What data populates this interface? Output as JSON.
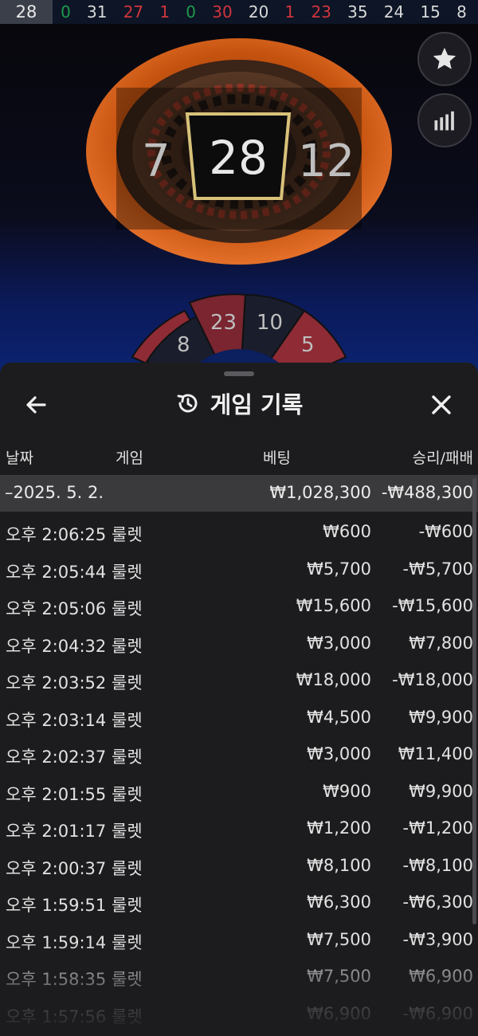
{
  "recent_results": {
    "current": "28",
    "numbers": [
      {
        "value": "0",
        "color": "green"
      },
      {
        "value": "31",
        "color": "black"
      },
      {
        "value": "27",
        "color": "red"
      },
      {
        "value": "1",
        "color": "red"
      },
      {
        "value": "0",
        "color": "green"
      },
      {
        "value": "30",
        "color": "red"
      },
      {
        "value": "20",
        "color": "black"
      },
      {
        "value": "1",
        "color": "red"
      },
      {
        "value": "23",
        "color": "red"
      },
      {
        "value": "35",
        "color": "black"
      },
      {
        "value": "24",
        "color": "black"
      },
      {
        "value": "15",
        "color": "black"
      },
      {
        "value": "8",
        "color": "black"
      }
    ]
  },
  "wheel": {
    "winning_number": "28",
    "left_neighbor": "7",
    "right_neighbor": "12",
    "lower_numbers": [
      "8",
      "23",
      "10",
      "5"
    ]
  },
  "side_buttons": {
    "favorite_icon": "star-icon",
    "stats_icon": "bar-chart-icon"
  },
  "history": {
    "title": "게임 기록",
    "columns": {
      "date": "날짜",
      "game": "게임",
      "bet": "베팅",
      "result": "승리/패배"
    },
    "date_group": {
      "label": "–2025. 5. 2.",
      "bet_total": "₩1,028,300",
      "result_total": "-₩488,300"
    },
    "rows": [
      {
        "time": "오후 2:06:25",
        "game": "룰렛",
        "bet": "₩600",
        "result": "-₩600"
      },
      {
        "time": "오후 2:05:44",
        "game": "룰렛",
        "bet": "₩5,700",
        "result": "-₩5,700"
      },
      {
        "time": "오후 2:05:06",
        "game": "룰렛",
        "bet": "₩15,600",
        "result": "-₩15,600"
      },
      {
        "time": "오후 2:04:32",
        "game": "룰렛",
        "bet": "₩3,000",
        "result": "₩7,800"
      },
      {
        "time": "오후 2:03:52",
        "game": "룰렛",
        "bet": "₩18,000",
        "result": "-₩18,000"
      },
      {
        "time": "오후 2:03:14",
        "game": "룰렛",
        "bet": "₩4,500",
        "result": "₩9,900"
      },
      {
        "time": "오후 2:02:37",
        "game": "룰렛",
        "bet": "₩3,000",
        "result": "₩11,400"
      },
      {
        "time": "오후 2:01:55",
        "game": "룰렛",
        "bet": "₩900",
        "result": "₩9,900"
      },
      {
        "time": "오후 2:01:17",
        "game": "룰렛",
        "bet": "₩1,200",
        "result": "-₩1,200"
      },
      {
        "time": "오후 2:00:37",
        "game": "룰렛",
        "bet": "₩8,100",
        "result": "-₩8,100"
      },
      {
        "time": "오후 1:59:51",
        "game": "룰렛",
        "bet": "₩6,300",
        "result": "-₩6,300"
      },
      {
        "time": "오후 1:59:14",
        "game": "룰렛",
        "bet": "₩7,500",
        "result": "-₩3,900"
      },
      {
        "time": "오후 1:58:35",
        "game": "룰렛",
        "bet": "₩7,500",
        "result": "₩6,900"
      },
      {
        "time": "오후 1:57:56",
        "game": "룰렛",
        "bet": "₩6,900",
        "result": "-₩6,900"
      }
    ]
  },
  "colors": {
    "red": "#d0353c",
    "black": "#d8d8d8",
    "green": "#1e9a4b",
    "gold": "#d8c27a"
  }
}
